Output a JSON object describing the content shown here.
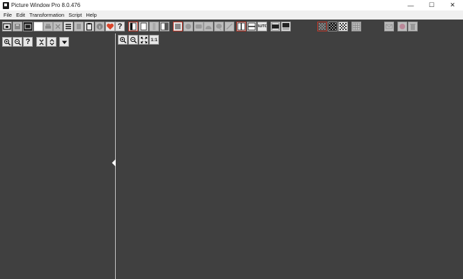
{
  "window": {
    "title": "Picture Window Pro 8.0.476",
    "minimize_glyph": "—",
    "maximize_glyph": "☐",
    "close_glyph": "✕"
  },
  "menu": [
    "File",
    "Edit",
    "Transformation",
    "Script",
    "Help"
  ],
  "toolbar": {
    "help_glyph": "?",
    "auto_label": "AUTO",
    "heart_color": "#d9462b"
  },
  "left_panel": {
    "help_glyph": "?"
  },
  "right_panel": {
    "one_to_one_label": "1:1"
  }
}
